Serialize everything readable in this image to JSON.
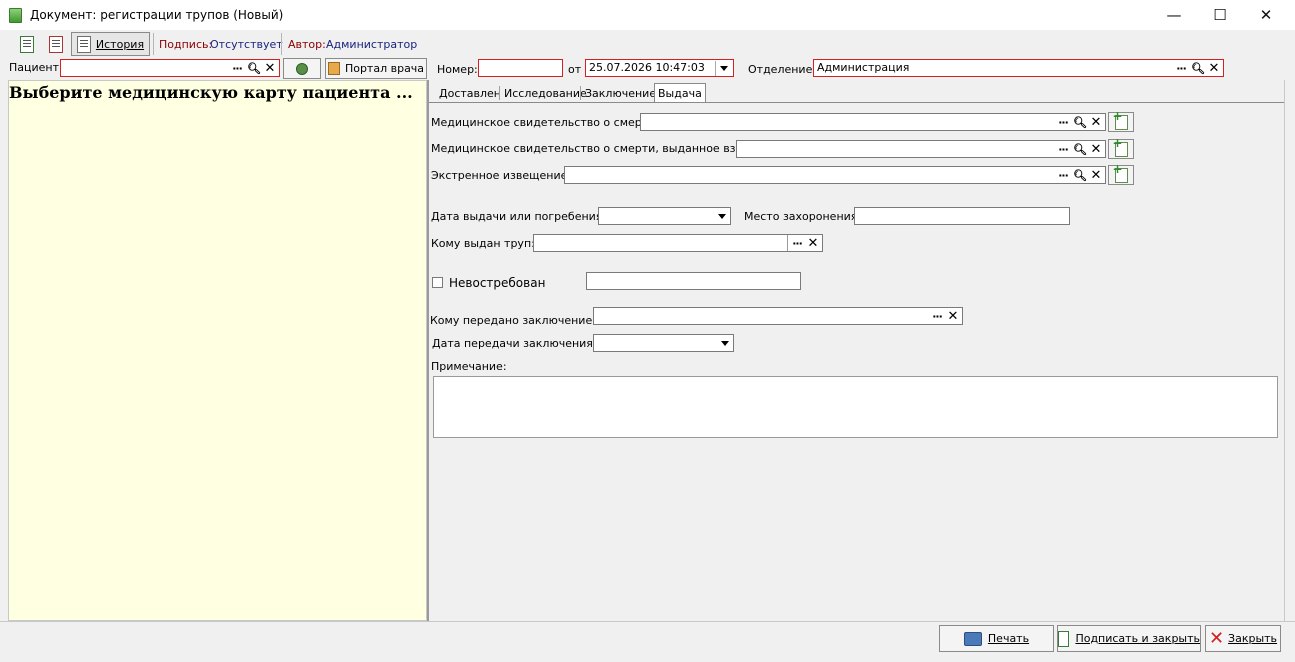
{
  "window": {
    "title": "Документ: регистрации трупов (Новый)",
    "minimize": "—",
    "maximize": "☐",
    "close": "✕"
  },
  "toolbar": {
    "history_label": "История",
    "sign_label": "Подпись:",
    "sign_value": "Отсутствует",
    "author_label": "Автор:",
    "author_value": "Администратор"
  },
  "patient": {
    "label": "Пациент:",
    "value": "",
    "portal_label": "Портал врача"
  },
  "header": {
    "number_label": "Номер:",
    "number_value": "",
    "from_label": "от",
    "date_value": "25.07.2026 10:47:03",
    "department_label": "Отделение:",
    "department_value": "Администрация"
  },
  "left_pane": {
    "placeholder": "Выберите медицинскую карту пациента ..."
  },
  "tabs": [
    {
      "label": "Доставлен",
      "active": false
    },
    {
      "label": "Исследование",
      "active": false
    },
    {
      "label": "Заключение",
      "active": false
    },
    {
      "label": "Выдача",
      "active": true
    }
  ],
  "form": {
    "death_cert_label": "Медицинское свидетельство о смерти:",
    "death_cert_value": "",
    "death_cert_replaced_label": "Медицинское свидетельство о смерти, выданное взамен:",
    "death_cert_replaced_value": "",
    "urgent_notice_label": "Экстренное извещение:",
    "urgent_notice_value": "",
    "issue_date_label": "Дата выдачи или погребения:",
    "issue_date_value": "",
    "burial_place_label": "Место захоронения:",
    "burial_place_value": "",
    "body_issued_to_label": "Кому выдан труп:",
    "body_issued_to_value": "",
    "unclaimed_label": "Невостребован",
    "unclaimed_checked": false,
    "unclaimed_note_value": "",
    "conclusion_to_label": "Кому передано заключение:",
    "conclusion_to_value": "",
    "conclusion_date_label": "Дата передачи заключения:",
    "conclusion_date_value": "",
    "note_label": "Примечание:",
    "note_value": ""
  },
  "footer": {
    "print_label": "Печать",
    "sign_close_label": "Подписать и закрыть",
    "close_label": "Закрыть"
  },
  "colors": {
    "required_border": "#d32020",
    "left_pane_bg": "#ffffe1",
    "sign_value_color": "#1a237e",
    "author_color": "#8b0000"
  }
}
